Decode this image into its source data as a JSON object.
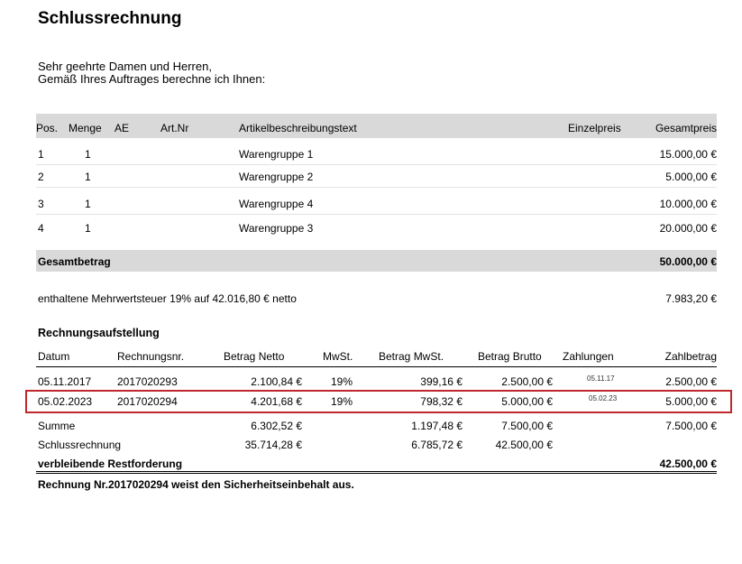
{
  "title": "Schlussrechnung",
  "intro": {
    "line1": "Sehr geehrte Damen und Herren,",
    "line2": "Gemäß Ihres Auftrages berechne ich Ihnen:"
  },
  "items_table": {
    "headers": {
      "pos": "Pos.",
      "menge": "Menge",
      "ae": "AE",
      "artnr": "Art.Nr",
      "beschreibung": "Artikelbeschreibungstext",
      "einzelpreis": "Einzelpreis",
      "gesamtpreis": "Gesamtpreis"
    },
    "rows": [
      {
        "pos": "1",
        "menge": "1",
        "beschreibung": "Warengruppe 1",
        "gesamtpreis": "15.000,00 €"
      },
      {
        "pos": "2",
        "menge": "1",
        "beschreibung": "Warengruppe 2",
        "gesamtpreis": "5.000,00 €"
      },
      {
        "pos": "3",
        "menge": "1",
        "beschreibung": "Warengruppe 4",
        "gesamtpreis": "10.000,00 €"
      },
      {
        "pos": "4",
        "menge": "1",
        "beschreibung": "Warengruppe 3",
        "gesamtpreis": "20.000,00 €"
      }
    ],
    "total_label": "Gesamtbetrag",
    "total_value": "50.000,00 €"
  },
  "vat": {
    "text": "enthaltene Mehrwertsteuer 19% auf 42.016,80 € netto",
    "value": "7.983,20 €"
  },
  "statement": {
    "heading": "Rechnungsaufstellung",
    "headers": {
      "datum": "Datum",
      "rechnungsnr": "Rechnungsnr.",
      "netto": "Betrag Netto",
      "mwst": "MwSt.",
      "betrag_mwst": "Betrag MwSt.",
      "brutto": "Betrag Brutto",
      "zahlungen": "Zahlungen",
      "zahlbetrag": "Zahlbetrag"
    },
    "rows": [
      {
        "datum": "05.11.2017",
        "rechnungsnr": "2017020293",
        "netto": "2.100,84 €",
        "mwst": "19%",
        "betrag_mwst": "399,16 €",
        "brutto": "2.500,00 €",
        "zahlungen": "05.11.17",
        "zahlbetrag": "2.500,00 €"
      },
      {
        "datum": "05.02.2023",
        "rechnungsnr": "2017020294",
        "netto": "4.201,68 €",
        "mwst": "19%",
        "betrag_mwst": "798,32 €",
        "brutto": "5.000,00 €",
        "zahlungen": "05.02.23",
        "zahlbetrag": "5.000,00 €"
      }
    ],
    "summe": {
      "label": "Summe",
      "netto": "6.302,52 €",
      "betrag_mwst": "1.197,48 €",
      "brutto": "7.500,00 €",
      "zahlbetrag": "7.500,00 €"
    },
    "schluss": {
      "label": "Schlussrechnung",
      "netto": "35.714,28 €",
      "betrag_mwst": "6.785,72 €",
      "brutto": "42.500,00 €"
    },
    "rest": {
      "label": "verbleibende Restforderung",
      "value": "42.500,00 €"
    }
  },
  "footer_note": "Rechnung Nr.2017020294  weist den Sicherheitseinbehalt aus."
}
